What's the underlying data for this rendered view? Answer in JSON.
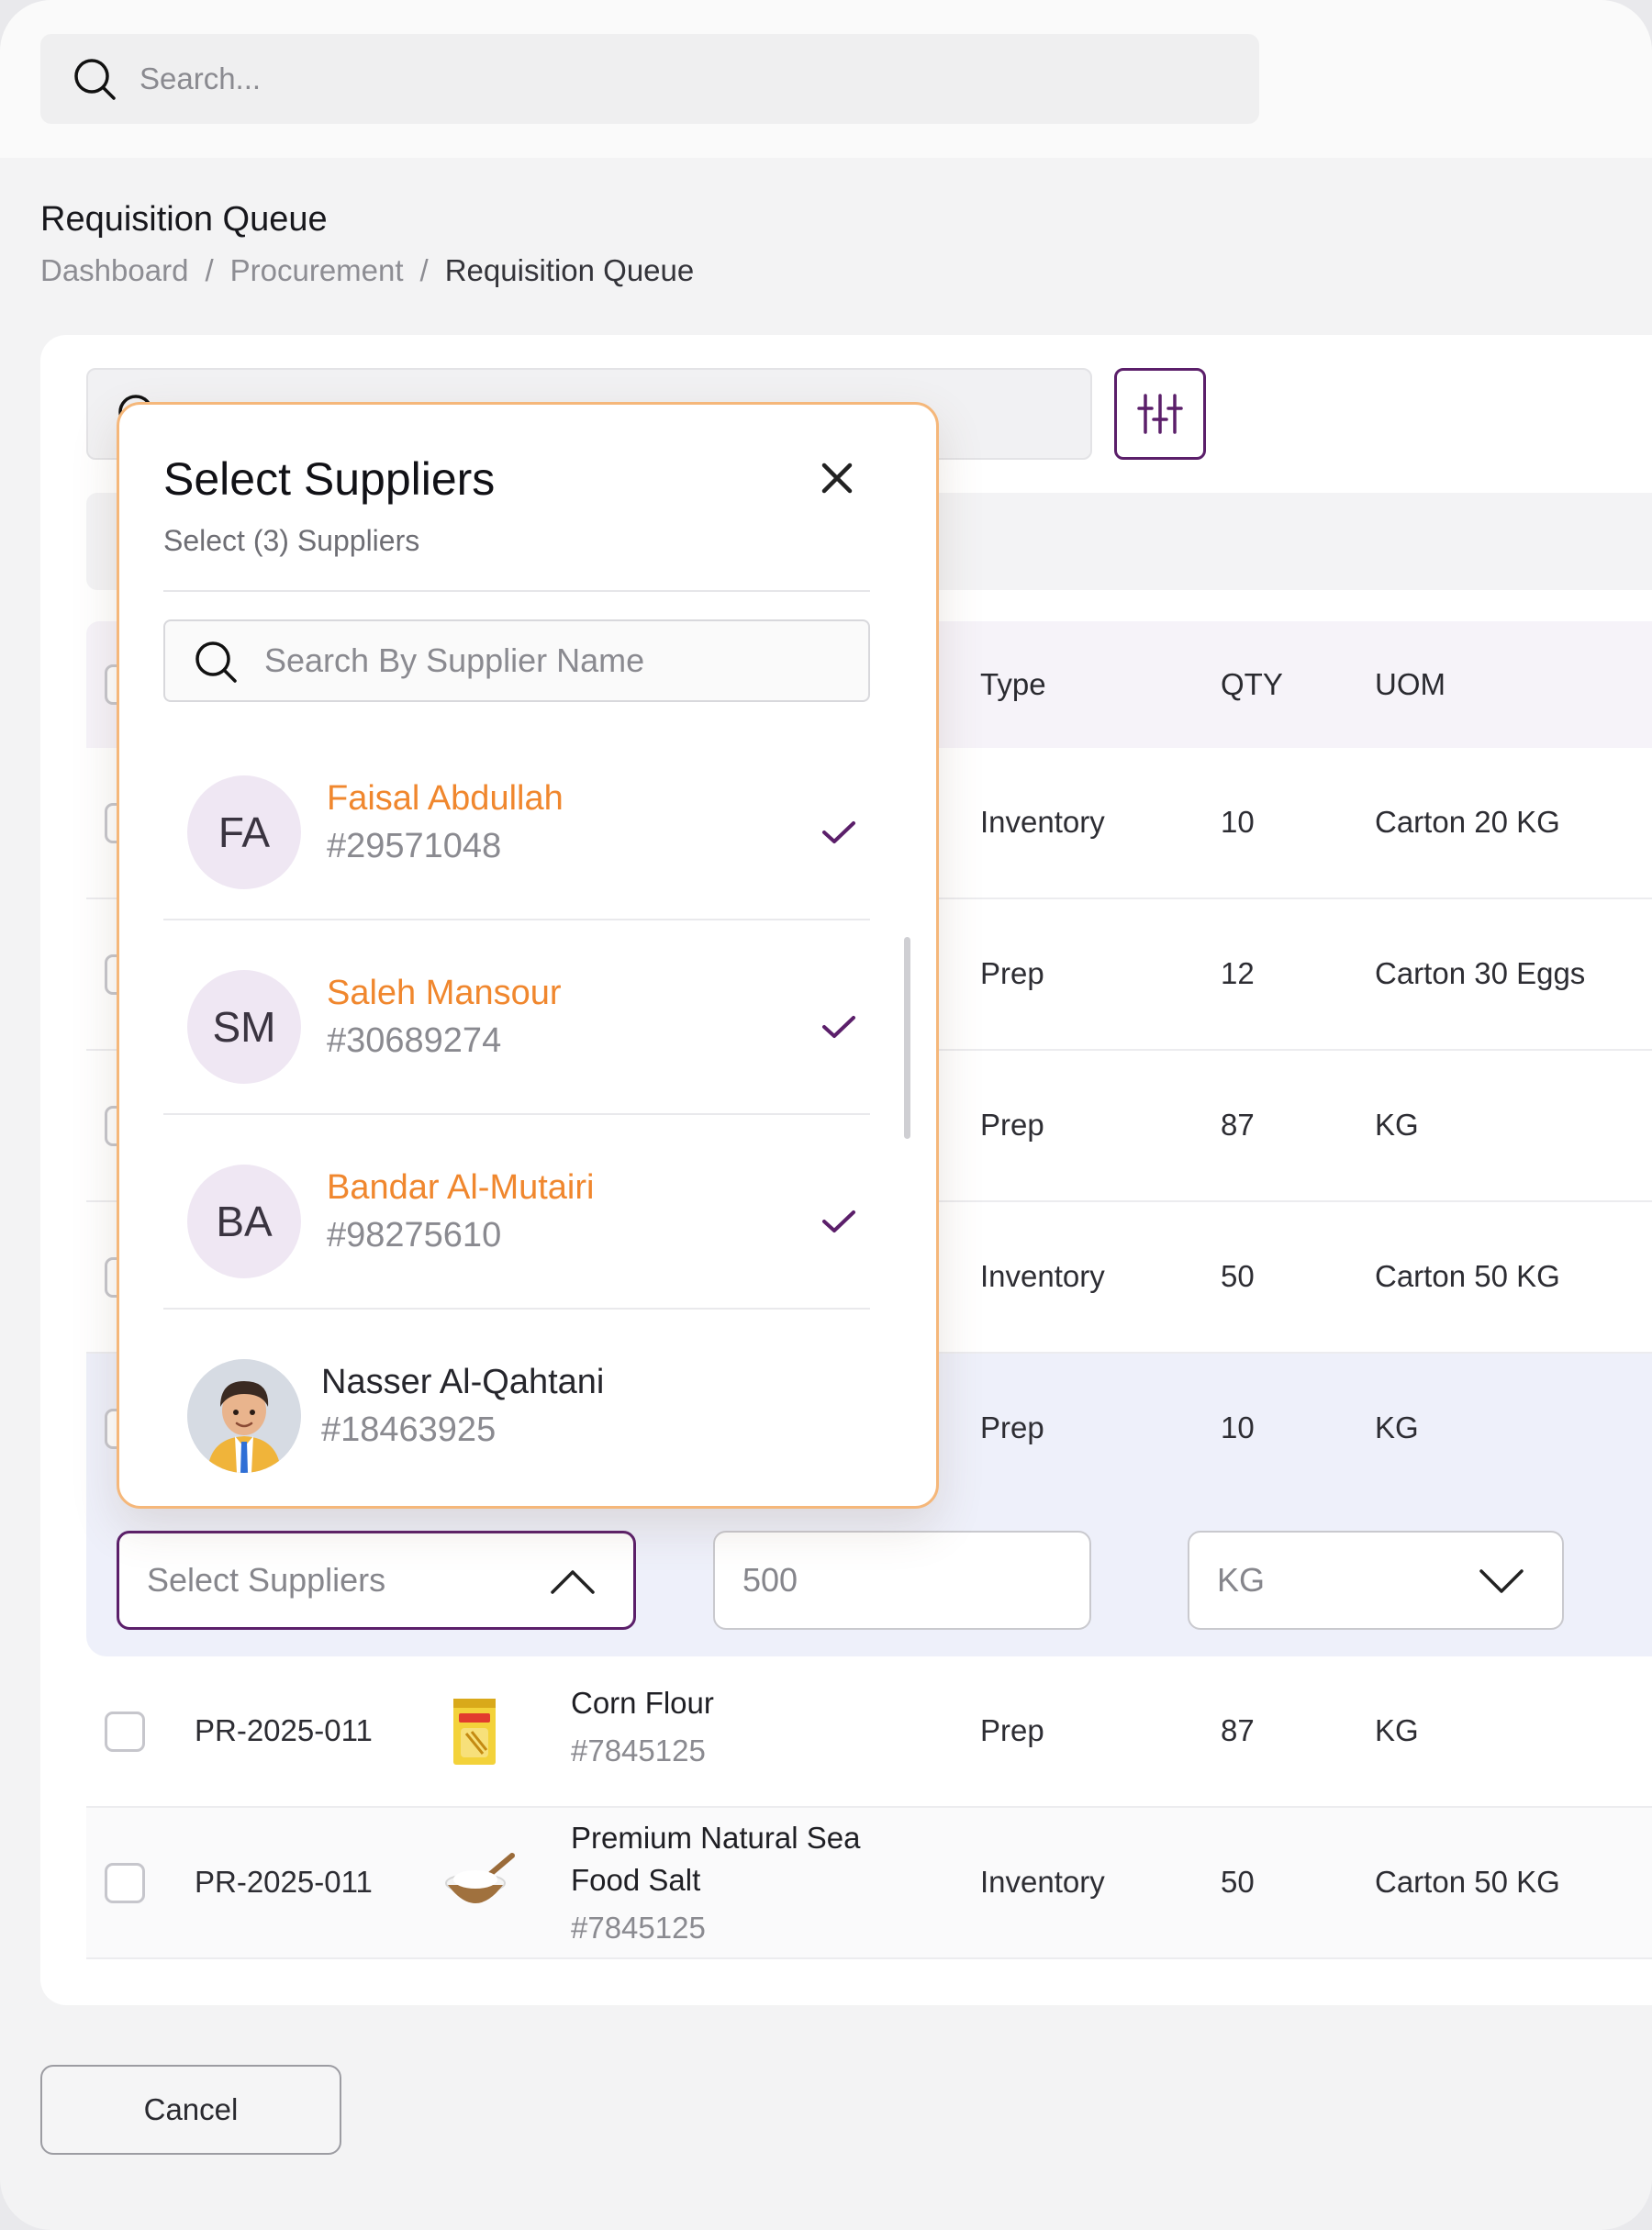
{
  "header": {
    "search_placeholder": "Search..."
  },
  "page": {
    "title": "Requisition Queue",
    "breadcrumb": [
      "Dashboard",
      "/",
      "Procurement",
      "/",
      "Requisition Queue"
    ]
  },
  "table": {
    "columns": {
      "type": "Type",
      "qty": "QTY",
      "uom": "UOM"
    },
    "rows": [
      {
        "type": "Inventory",
        "qty": "10",
        "uom": "Carton 20 KG"
      },
      {
        "type": "Prep",
        "qty": "12",
        "uom": "Carton 30 Eggs"
      },
      {
        "type": "Prep",
        "qty": "87",
        "uom": "KG"
      },
      {
        "type": "Inventory",
        "qty": "50",
        "uom": "Carton 50 KG"
      },
      {
        "type": "Prep",
        "qty": "10",
        "uom": "KG"
      }
    ],
    "edit_row": {
      "supplier_placeholder": "Select Suppliers",
      "qty_value": "500",
      "uom_value": "KG"
    },
    "lower_rows": [
      {
        "id": "PR-2025-011",
        "product_name": "Corn Flour",
        "product_code": "#7845125",
        "type": "Prep",
        "qty": "87",
        "uom": "KG"
      },
      {
        "id": "PR-2025-011",
        "product_name_line1": "Premium Natural Sea",
        "product_name_line2": "Food Salt",
        "product_code": "#7845125",
        "type": "Inventory",
        "qty": "50",
        "uom": "Carton 50 KG"
      }
    ]
  },
  "actions": {
    "cancel_label": "Cancel"
  },
  "popover": {
    "title": "Select Suppliers",
    "subtitle": "Select (3) Suppliers",
    "search_placeholder": "Search By Supplier Name",
    "suppliers": [
      {
        "initials": "FA",
        "name": "Faisal Abdullah",
        "id": "#29571048",
        "selected": true
      },
      {
        "initials": "SM",
        "name": "Saleh Mansour",
        "id": "#30689274",
        "selected": true
      },
      {
        "initials": "BA",
        "name": "Bandar Al-Mutairi",
        "id": "#98275610",
        "selected": true
      },
      {
        "name": "Nasser Al-Qahtani",
        "id": "#18463925",
        "selected": false,
        "avatar": "person-avatar"
      }
    ]
  },
  "colors": {
    "accent_purple": "#5b1f6a",
    "selected_name": "#f0872e",
    "popover_border": "#f5b77a",
    "check": "#5b1f6a"
  }
}
